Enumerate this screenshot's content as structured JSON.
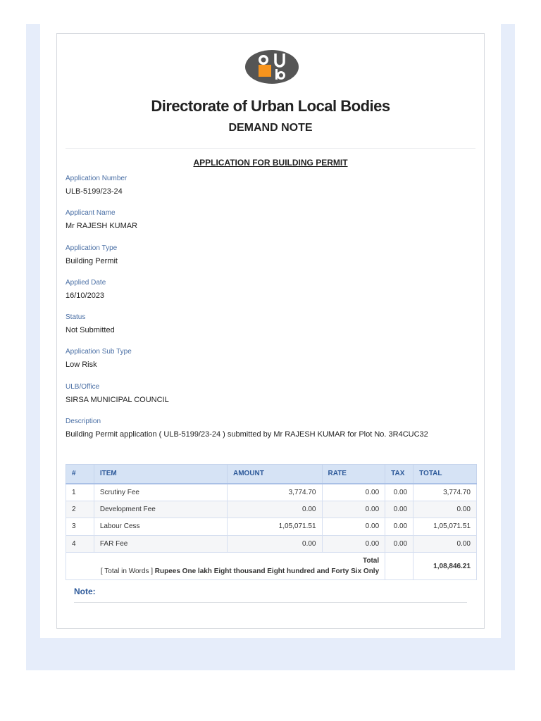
{
  "header": {
    "title": "Directorate of Urban Local Bodies",
    "subtitle": "DEMAND NOTE",
    "logo_text": "ulb"
  },
  "section_title": "APPLICATION FOR BUILDING PERMIT",
  "fields": [
    {
      "label": "Application Number",
      "value": "ULB-5199/23-24"
    },
    {
      "label": "Applicant Name",
      "value": "Mr RAJESH KUMAR"
    },
    {
      "label": "Application Type",
      "value": "Building Permit"
    },
    {
      "label": "Applied Date",
      "value": "16/10/2023"
    },
    {
      "label": "Status",
      "value": "Not Submitted"
    },
    {
      "label": "Application Sub Type",
      "value": "Low Risk"
    },
    {
      "label": "ULB/Office",
      "value": "SIRSA MUNICIPAL COUNCIL"
    },
    {
      "label": "Description",
      "value": "Building Permit application ( ULB-5199/23-24 ) submitted by Mr RAJESH KUMAR for Plot No. 3R4CUC32"
    }
  ],
  "table": {
    "headers": [
      "#",
      "ITEM",
      "AMOUNT",
      "RATE",
      "TAX",
      "TOTAL"
    ],
    "rows": [
      [
        "1",
        "Scrutiny Fee",
        "3,774.70",
        "0.00",
        "0.00",
        "3,774.70"
      ],
      [
        "2",
        "Development Fee",
        "0.00",
        "0.00",
        "0.00",
        "0.00"
      ],
      [
        "3",
        "Labour Cess",
        "1,05,071.51",
        "0.00",
        "0.00",
        "1,05,071.51"
      ],
      [
        "4",
        "FAR Fee",
        "0.00",
        "0.00",
        "0.00",
        "0.00"
      ]
    ],
    "total_label": "Total",
    "words_prefix": "[ Total in Words ]",
    "words": "Rupees One lakh Eight thousand Eight hundred and Forty Six Only",
    "total_value": "1,08,846.21"
  },
  "note_label": "Note:",
  "colors": {
    "accent": "#2e5a9a",
    "logo_orange": "#f7941d",
    "logo_gray": "#555555"
  }
}
